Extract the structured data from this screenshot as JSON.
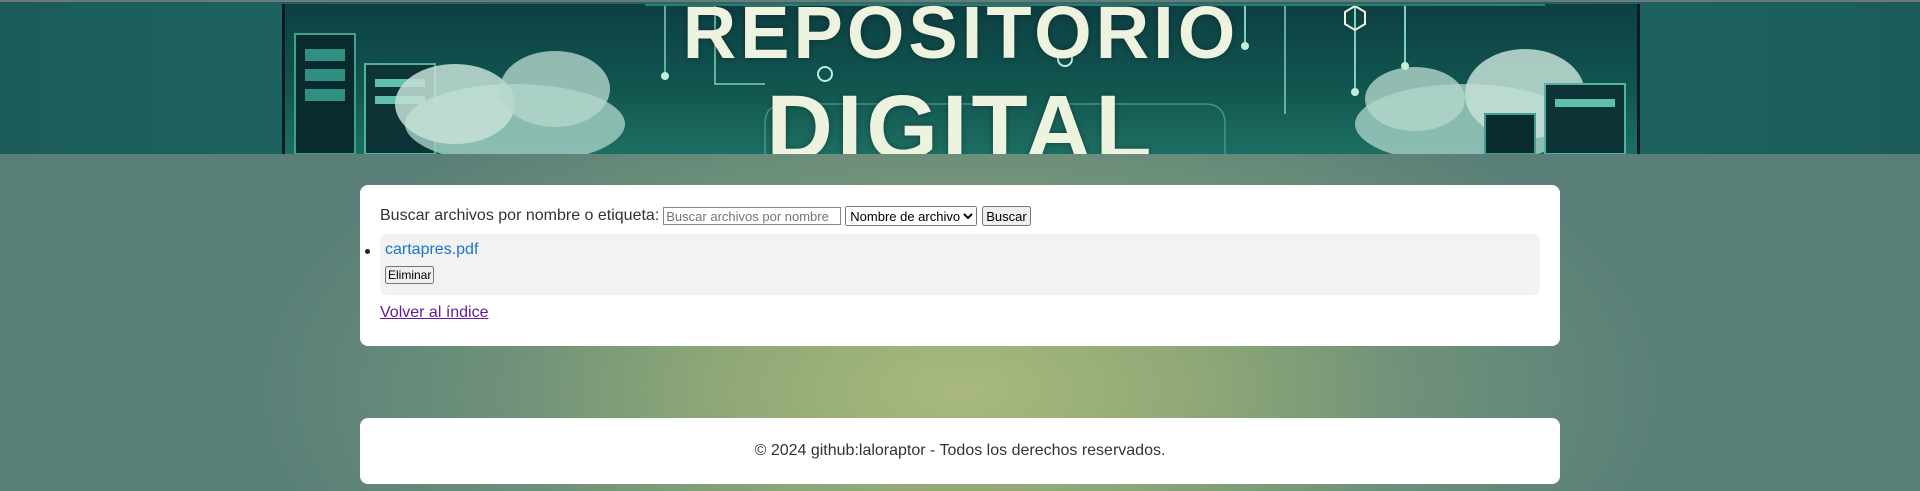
{
  "header": {
    "banner_line1": "REPOSITORIO",
    "banner_line2": "DIGITAL"
  },
  "search": {
    "label": "Buscar archivos por nombre o etiqueta:",
    "placeholder": "Buscar archivos por nombre",
    "filter_selected": "Nombre de archivo",
    "button_label": "Buscar"
  },
  "files": [
    {
      "name": "cartapres.pdf",
      "delete_label": "Eliminar"
    }
  ],
  "back_link": "Volver al índice",
  "footer": {
    "text": "© 2024 github:laloraptor - Todos los derechos reservados."
  },
  "colors": {
    "link": "#1a73d9",
    "visited_link": "#6a1b9a",
    "header_teal": "#1b5c5a",
    "background_center": "#a9b97c",
    "background_edge": "#5a7f78"
  }
}
